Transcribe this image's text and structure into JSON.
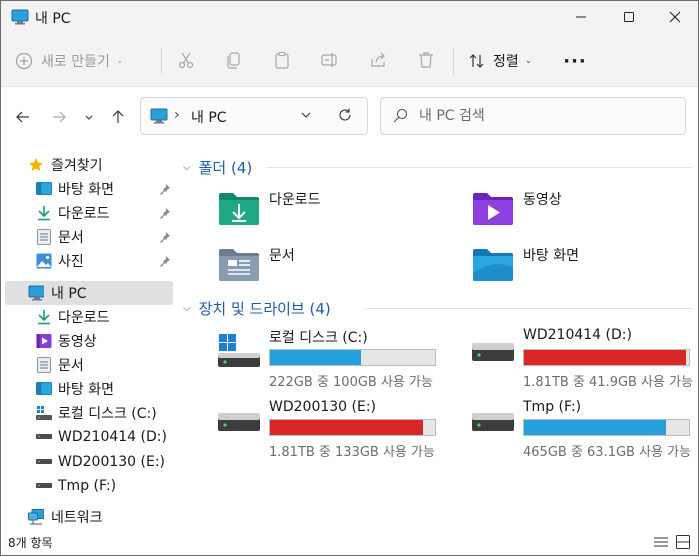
{
  "window": {
    "title": "내 PC"
  },
  "toolbar": {
    "new_label": "새로 만들기",
    "sort_label": "정렬",
    "more_label": "···"
  },
  "address": {
    "separator": "›",
    "path": "내 PC"
  },
  "search": {
    "placeholder": "내 PC 검색"
  },
  "sidebar": {
    "quick_access": "즐겨찾기",
    "quick_items": [
      "바탕 화면",
      "다운로드",
      "문서",
      "사진"
    ],
    "this_pc": "내 PC",
    "pc_items": [
      "다운로드",
      "동영상",
      "문서",
      "바탕 화면",
      "로컬 디스크 (C:)",
      "WD210414 (D:)",
      "WD200130 (E:)",
      "Tmp (F:)"
    ],
    "network": "네트워크"
  },
  "content": {
    "folders_header": "폴더 (4)",
    "folders": [
      "다운로드",
      "동영상",
      "문서",
      "바탕 화면"
    ],
    "drives_header": "장치 및 드라이브 (4)",
    "drives": [
      {
        "name": "로컬 디스크 (C:)",
        "detail": "222GB 중 100GB 사용 가능",
        "used_fraction": 0.55,
        "color": "#26a0da"
      },
      {
        "name": "WD210414 (D:)",
        "detail": "1.81TB 중 41.9GB 사용 가능",
        "used_fraction": 0.98,
        "color": "#da2626"
      },
      {
        "name": "WD200130 (E:)",
        "detail": "1.81TB 중 133GB 사용 가능",
        "used_fraction": 0.93,
        "color": "#da2626"
      },
      {
        "name": "Tmp (F:)",
        "detail": "465GB 중 63.1GB 사용 가능",
        "used_fraction": 0.86,
        "color": "#26a0da"
      }
    ]
  },
  "status": {
    "item_count": "8개 항목"
  },
  "colors": {
    "accent": "#1b5fa8",
    "drive_ok": "#26a0da",
    "drive_full": "#da2626"
  }
}
